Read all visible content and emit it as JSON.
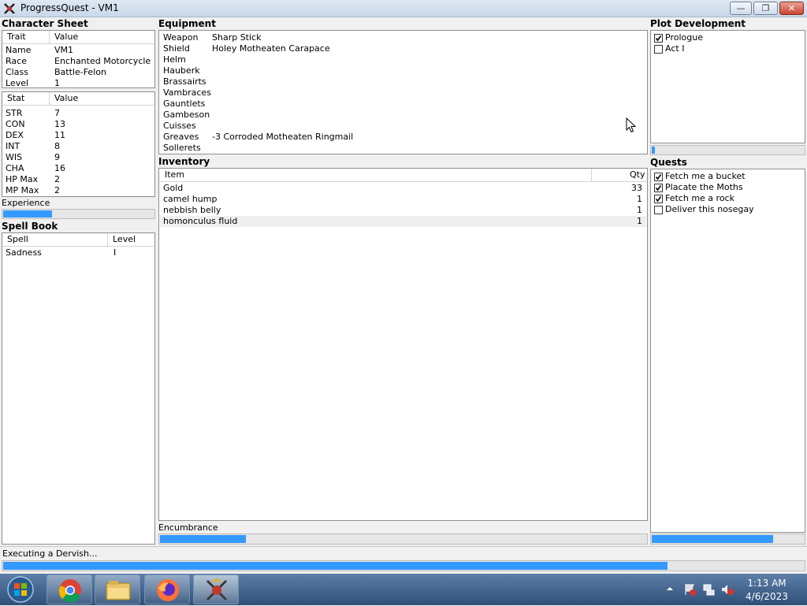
{
  "window": {
    "title": "ProgressQuest - VM1"
  },
  "character_sheet": {
    "title": "Character Sheet",
    "trait_headers": [
      "Trait",
      "Value"
    ],
    "traits": [
      {
        "label": "Name",
        "value": "VM1"
      },
      {
        "label": "Race",
        "value": "Enchanted Motorcycle"
      },
      {
        "label": "Class",
        "value": "Battle-Felon"
      },
      {
        "label": "Level",
        "value": "1"
      }
    ],
    "stat_headers": [
      "Stat",
      "Value"
    ],
    "stats": [
      {
        "label": "STR",
        "value": "7"
      },
      {
        "label": "CON",
        "value": "13"
      },
      {
        "label": "DEX",
        "value": "11"
      },
      {
        "label": "INT",
        "value": "8"
      },
      {
        "label": "WIS",
        "value": "9"
      },
      {
        "label": "CHA",
        "value": "16"
      },
      {
        "label": "HP Max",
        "value": "2"
      },
      {
        "label": "MP Max",
        "value": "2"
      }
    ],
    "experience_label": "Experience",
    "experience_progress": 0.33
  },
  "spell_book": {
    "title": "Spell Book",
    "headers": [
      "Spell",
      "Level"
    ],
    "spells": [
      {
        "name": "Sadness",
        "level": "I"
      }
    ]
  },
  "equipment": {
    "title": "Equipment",
    "slots": [
      {
        "slot": "Weapon",
        "item": "Sharp Stick"
      },
      {
        "slot": "Shield",
        "item": "Holey Motheaten Carapace"
      },
      {
        "slot": "Helm",
        "item": ""
      },
      {
        "slot": "Hauberk",
        "item": ""
      },
      {
        "slot": "Brassairts",
        "item": ""
      },
      {
        "slot": "Vambraces",
        "item": ""
      },
      {
        "slot": "Gauntlets",
        "item": ""
      },
      {
        "slot": "Gambeson",
        "item": ""
      },
      {
        "slot": "Cuisses",
        "item": ""
      },
      {
        "slot": "Greaves",
        "item": "-3 Corroded Motheaten Ringmail"
      },
      {
        "slot": "Sollerets",
        "item": ""
      }
    ]
  },
  "inventory": {
    "title": "Inventory",
    "headers": [
      "Item",
      "Qty"
    ],
    "items": [
      {
        "item": "Gold",
        "qty": "33"
      },
      {
        "item": "camel hump",
        "qty": "1"
      },
      {
        "item": "nebbish belly",
        "qty": "1"
      },
      {
        "item": "homonculus fluid",
        "qty": "1"
      }
    ],
    "encumbrance_label": "Encumbrance",
    "encumbrance_progress": 0.18
  },
  "plot": {
    "title": "Plot Development",
    "acts": [
      {
        "label": "Prologue",
        "checked": true
      },
      {
        "label": "Act I",
        "checked": false
      }
    ],
    "progress": 0.03
  },
  "quests": {
    "title": "Quests",
    "items": [
      {
        "label": "Fetch me a bucket",
        "checked": true
      },
      {
        "label": "Placate the Moths",
        "checked": true
      },
      {
        "label": "Fetch me a rock",
        "checked": true
      },
      {
        "label": "Deliver this nosegay",
        "checked": false
      }
    ],
    "progress": 0.8
  },
  "status": {
    "text": "Executing a Dervish...",
    "progress": 0.83
  },
  "taskbar": {
    "time": "1:13 AM",
    "date": "4/6/2023",
    "icons": [
      "start-orb-icon",
      "chrome-icon",
      "file-explorer-icon",
      "firefox-icon",
      "progressquest-icon"
    ]
  },
  "colors": {
    "progress": "#3399ff",
    "taskbar": "#3f608a"
  }
}
